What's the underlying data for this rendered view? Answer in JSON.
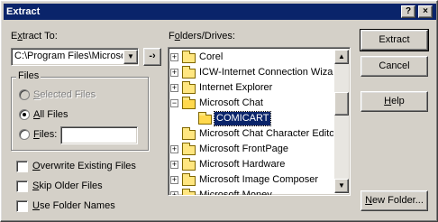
{
  "window": {
    "title": "Extract",
    "help_button": "?",
    "close_button": "×"
  },
  "extract_to": {
    "label_pre": "E",
    "label_u": "x",
    "label_post": "tract To:",
    "path_value": "C:\\Program Files\\Microso",
    "combo_arrow": "▼",
    "go_button": "-›"
  },
  "files_group": {
    "title": "Files",
    "options": [
      {
        "label_u": "S",
        "label_post": "elected Files",
        "checked": false,
        "disabled": true
      },
      {
        "label_u": "A",
        "label_post": "ll Files",
        "checked": true,
        "disabled": false
      },
      {
        "label_u": "F",
        "label_post": "iles:",
        "checked": false,
        "disabled": false
      }
    ],
    "files_input_value": ""
  },
  "checkboxes": [
    {
      "label_u": "O",
      "label_post": "verwrite Existing Files",
      "checked": false
    },
    {
      "label_u": "S",
      "label_post": "kip Older Files",
      "checked": false
    },
    {
      "label_u": "U",
      "label_post": "se Folder Names",
      "checked": false
    }
  ],
  "folders": {
    "label_pre": "F",
    "label_u": "o",
    "label_post": "lders/Drives:",
    "items": [
      {
        "label": "Corel",
        "expanded": false,
        "has_children": true
      },
      {
        "label": "ICW-Internet Connection Wizard",
        "expanded": false,
        "has_children": true
      },
      {
        "label": "Internet Explorer",
        "expanded": false,
        "has_children": true
      },
      {
        "label": "Microsoft Chat",
        "expanded": true,
        "has_children": true
      },
      {
        "label": "COMICART",
        "selected": true,
        "child": true
      },
      {
        "label": "Microsoft Chat Character Editor",
        "expanded": false,
        "has_children": false
      },
      {
        "label": "Microsoft FrontPage",
        "expanded": false,
        "has_children": true
      },
      {
        "label": "Microsoft Hardware",
        "expanded": false,
        "has_children": true
      },
      {
        "label": "Microsoft Image Composer",
        "expanded": false,
        "has_children": true
      },
      {
        "label": "Microsoft Money",
        "expanded": false,
        "has_children": true
      }
    ],
    "scroll_up": "▲",
    "scroll_down": "▼"
  },
  "buttons": {
    "extract": "Extract",
    "cancel": "Cancel",
    "help_u": "H",
    "help_post": "elp",
    "new_folder_u": "N",
    "new_folder_post": "ew Folder..."
  },
  "colors": {
    "titlebar": "#0a246a",
    "selection": "#0a246a",
    "face": "#d4d0c8"
  }
}
